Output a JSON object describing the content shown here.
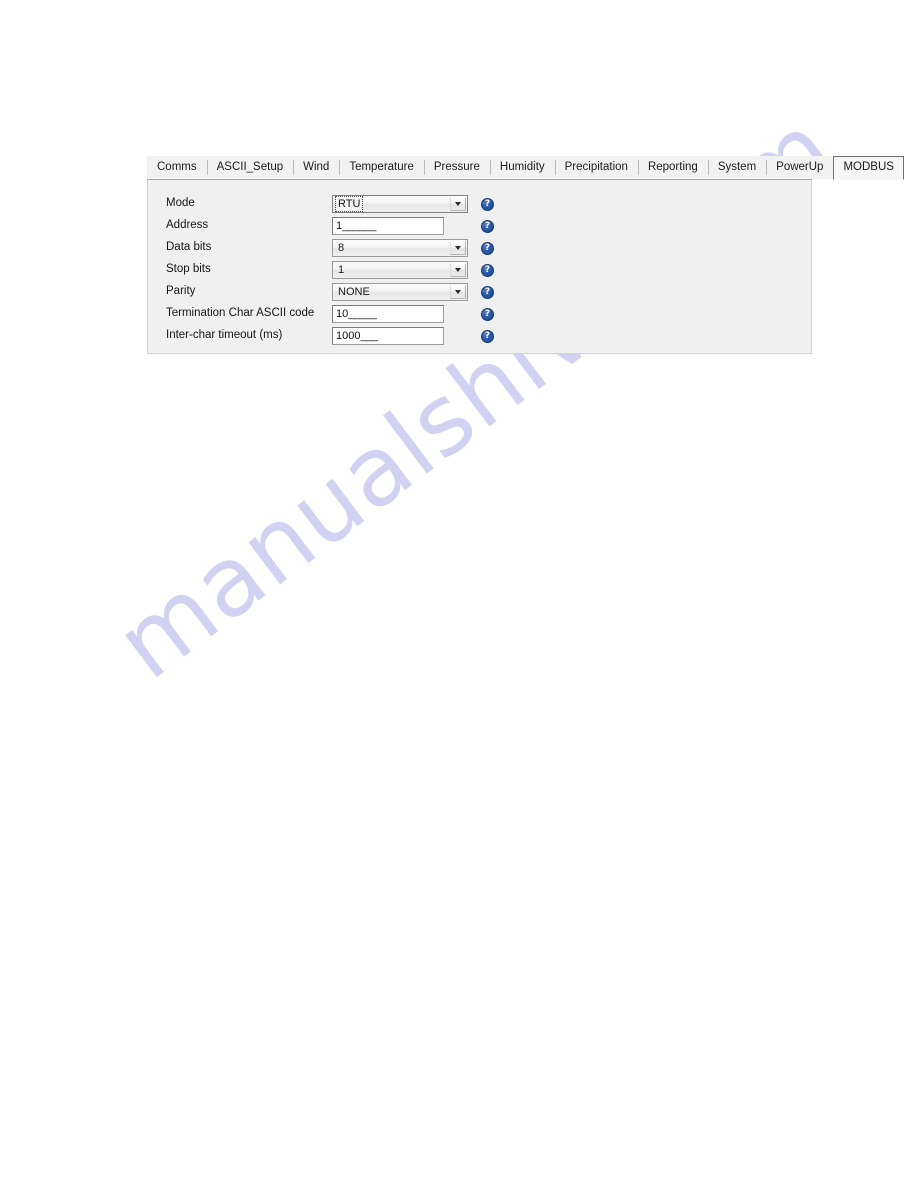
{
  "window": {
    "active_tab": "MODBUS"
  },
  "tabs": [
    {
      "label": "Comms",
      "active": false
    },
    {
      "label": "ASCII_Setup",
      "active": false
    },
    {
      "label": "Wind",
      "active": false
    },
    {
      "label": "Temperature",
      "active": false
    },
    {
      "label": "Pressure",
      "active": false
    },
    {
      "label": "Humidity",
      "active": false
    },
    {
      "label": "Precipitation",
      "active": false
    },
    {
      "label": "Reporting",
      "active": false
    },
    {
      "label": "System",
      "active": false
    },
    {
      "label": "PowerUp",
      "active": false
    },
    {
      "label": "MODBUS",
      "active": true
    }
  ],
  "form": {
    "rows": [
      {
        "label": "Mode",
        "control": "combo",
        "value": "RTU",
        "focused": true,
        "help_icon": "help-question-icon",
        "help_label": "?"
      },
      {
        "label": "Address",
        "control": "text",
        "value": "1",
        "padding": "______",
        "focused": false,
        "help_icon": "help-question-icon",
        "help_label": "?"
      },
      {
        "label": "Data bits",
        "control": "combo",
        "value": "8",
        "focused": false,
        "help_icon": "help-question-icon",
        "help_label": "?"
      },
      {
        "label": "Stop bits",
        "control": "combo",
        "value": "1",
        "focused": false,
        "help_icon": "help-question-icon",
        "help_label": "?"
      },
      {
        "label": "Parity",
        "control": "combo",
        "value": "NONE",
        "focused": false,
        "help_icon": "help-question-icon",
        "help_label": "?"
      },
      {
        "label": "Termination Char ASCII code",
        "control": "text",
        "value": "10",
        "padding": "_____",
        "focused": false,
        "help_icon": "help-question-icon",
        "help_label": "?"
      },
      {
        "label": "Inter-char timeout (ms)",
        "control": "text",
        "value": "1000",
        "padding": "___",
        "focused": false,
        "help_icon": "help-question-icon",
        "help_label": "?"
      }
    ]
  },
  "watermark": {
    "text": "manualshive.com",
    "color": "#c9c9ef"
  },
  "colors": {
    "panel_bg": "#f0f0f0",
    "tab_bg": "#f2f2f2",
    "help_blue": "#2f5aa8",
    "input_bg": "#ffffff",
    "text": "#141414"
  }
}
